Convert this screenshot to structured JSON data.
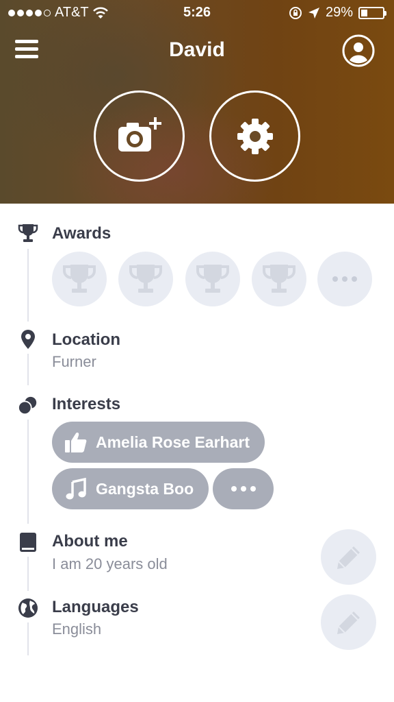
{
  "status_bar": {
    "carrier": "AT&T",
    "time": "5:26",
    "battery": "29%",
    "battery_level": 0.29
  },
  "header": {
    "title": "David"
  },
  "awards": {
    "title": "Awards",
    "count": 4
  },
  "location": {
    "title": "Location",
    "value": "Furner"
  },
  "interests": {
    "title": "Interests",
    "items": [
      {
        "label": "Amelia Rose Earhart",
        "icon": "thumbs-up-icon"
      },
      {
        "label": "Gangsta Boo",
        "icon": "music-note-icon"
      }
    ]
  },
  "about": {
    "title": "About me",
    "value": "I am 20 years old"
  },
  "languages": {
    "title": "Languages",
    "value": "English"
  },
  "colors": {
    "icon_dark": "#3a3d4a",
    "muted": "#8a8d99",
    "pill": "#a9adb8",
    "circle_bg": "#e9ecf3"
  }
}
